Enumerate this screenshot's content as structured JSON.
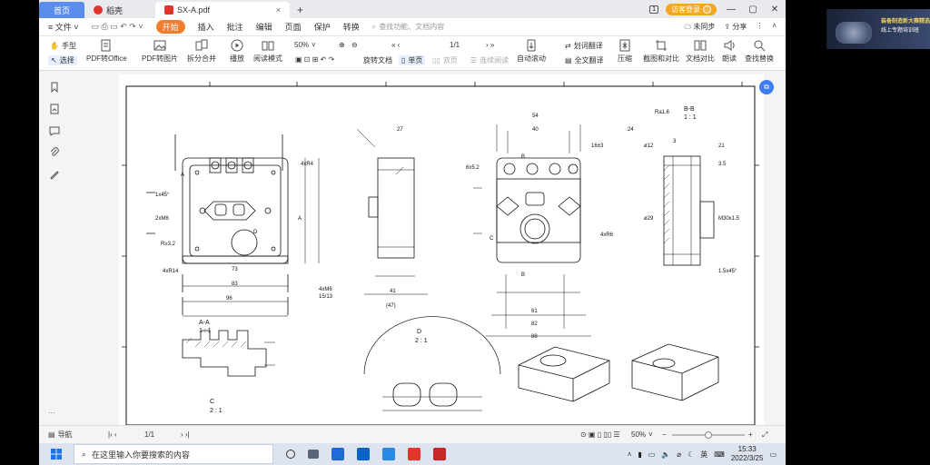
{
  "titlebar": {
    "home_tab": "首页",
    "docer_tab": "稻壳",
    "active_tab": "SX-A.pdf",
    "new_tab": "+",
    "tab_count": "1",
    "login": "访客登录"
  },
  "menubar": {
    "file": "文件",
    "start": "开始",
    "insert": "插入",
    "annotate": "批注",
    "edit": "编辑",
    "page": "页面",
    "protect": "保护",
    "convert": "转换",
    "search": "查找功能、文档内容",
    "sync": "未同步",
    "share": "分享"
  },
  "ribbon": {
    "hand": "手型",
    "select": "选择",
    "pdf_office": "PDF转Office",
    "pdf_image": "PDF转图片",
    "split_merge": "拆分合并",
    "play": "播放",
    "read_mode": "阅读模式",
    "zoom": "50%",
    "page_num": "1/1",
    "rotate": "旋转文档",
    "single": "单页",
    "double": "双页",
    "continuous": "连续阅读",
    "auto_scroll": "自动滚动",
    "translate": "划词翻译",
    "full_translate": "全文翻译",
    "compress": "压缩",
    "screenshot": "截图和对比",
    "compare": "文档对比",
    "read_aloud": "朗读",
    "find_replace": "查找替换"
  },
  "drawing": {
    "labels": [
      "A-A",
      "1 : 1",
      "B-B",
      "1 : 1",
      "C",
      "2 : 1",
      "D",
      "2 : 1",
      "A",
      "A",
      "B",
      "B",
      "C",
      "D"
    ],
    "dims": [
      "54",
      "40",
      "16±3",
      "24",
      "61",
      "82",
      "88",
      "73",
      "83",
      "96",
      "41",
      "(47)",
      "27",
      "6x5.2",
      "4xR4",
      "4xR14",
      "4xM6",
      "4xR6",
      "R≥3.2",
      "1x45°",
      "2xM6",
      "ø12",
      "ø29",
      "3",
      "21",
      "3.5",
      "3",
      "M30x1.5",
      "1.5x45°",
      "Ra1.6",
      "15/13"
    ]
  },
  "statusbar": {
    "nav": "导航",
    "page": "1/1",
    "zoom": "50%"
  },
  "taskbar": {
    "search": "在这里输入你要搜索的内容",
    "time": "15:33",
    "date": "2022/3/25",
    "lang": "英"
  },
  "thumb": {
    "title": "装备制造新大赛精选",
    "subtitle": "线上专题培训班"
  }
}
